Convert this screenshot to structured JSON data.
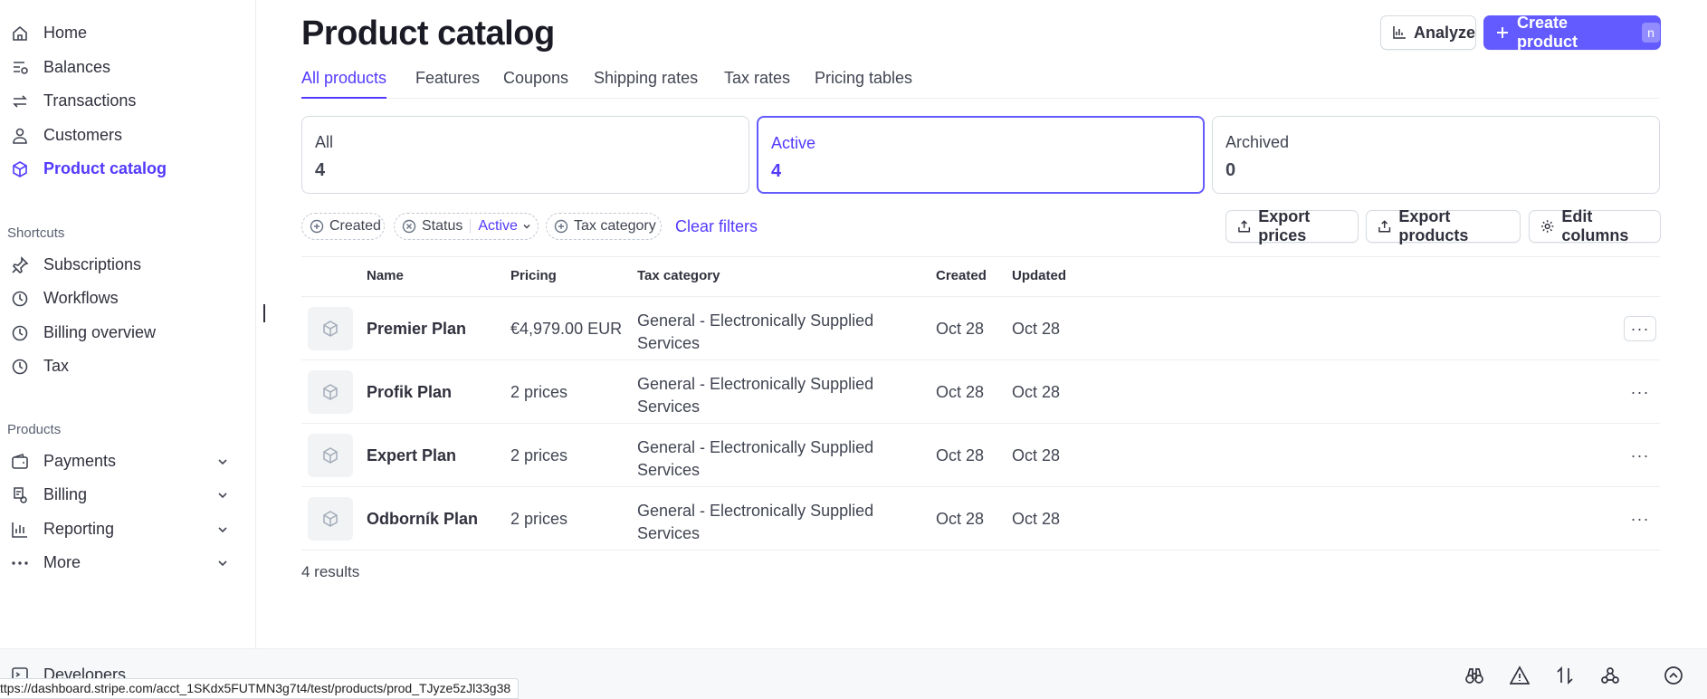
{
  "sidebar": {
    "items": [
      {
        "label": "Home",
        "icon": "home-icon"
      },
      {
        "label": "Balances",
        "icon": "balances-icon"
      },
      {
        "label": "Transactions",
        "icon": "transactions-icon"
      },
      {
        "label": "Customers",
        "icon": "customers-icon"
      },
      {
        "label": "Product catalog",
        "icon": "product-catalog-icon",
        "active": true
      }
    ],
    "shortcuts_label": "Shortcuts",
    "shortcuts": [
      {
        "label": "Subscriptions",
        "icon": "pin-icon"
      },
      {
        "label": "Workflows",
        "icon": "clock-icon"
      },
      {
        "label": "Billing overview",
        "icon": "clock-icon"
      },
      {
        "label": "Tax",
        "icon": "clock-icon"
      }
    ],
    "products_label": "Products",
    "products": [
      {
        "label": "Payments",
        "icon": "wallet-icon"
      },
      {
        "label": "Billing",
        "icon": "billing-icon"
      },
      {
        "label": "Reporting",
        "icon": "bar-chart-icon"
      },
      {
        "label": "More",
        "icon": "more-dots-icon"
      }
    ],
    "developers_label": "Developers"
  },
  "header": {
    "title": "Product catalog",
    "analyze_label": "Analyze",
    "create_label": "Create product",
    "create_shortcut": "n"
  },
  "tabs": [
    "All products",
    "Features",
    "Coupons",
    "Shipping rates",
    "Tax rates",
    "Pricing tables"
  ],
  "summary_cards": [
    {
      "label": "All",
      "value": "4"
    },
    {
      "label": "Active",
      "value": "4",
      "selected": true
    },
    {
      "label": "Archived",
      "value": "0"
    }
  ],
  "filters": {
    "created": "Created",
    "status": "Status",
    "status_value": "Active",
    "tax_category": "Tax category",
    "clear": "Clear filters"
  },
  "actions": {
    "export_prices": "Export prices",
    "export_products": "Export products",
    "edit_columns": "Edit columns"
  },
  "table": {
    "columns": [
      "Name",
      "Pricing",
      "Tax category",
      "Created",
      "Updated"
    ],
    "rows": [
      {
        "name": "Premier Plan",
        "pricing": "€4,979.00 EUR",
        "tax_line1": "General - Electronically Supplied",
        "tax_line2": "Services",
        "created": "Oct 28",
        "updated": "Oct 28"
      },
      {
        "name": "Profik Plan",
        "pricing": "2 prices",
        "tax_line1": "General - Electronically Supplied",
        "tax_line2": "Services",
        "created": "Oct 28",
        "updated": "Oct 28"
      },
      {
        "name": "Expert Plan",
        "pricing": "2 prices",
        "tax_line1": "General - Electronically Supplied",
        "tax_line2": "Services",
        "created": "Oct 28",
        "updated": "Oct 28"
      },
      {
        "name": "Odborník Plan",
        "pricing": "2 prices",
        "tax_line1": "General - Electronically Supplied",
        "tax_line2": "Services",
        "created": "Oct 28",
        "updated": "Oct 28"
      }
    ],
    "more_glyph": "···",
    "results": "4 results"
  },
  "status_url": "ttps://dashboard.stripe.com/acct_1SKdx5FUTMN3g7t4/test/products/prod_TJyze5zJl33g38",
  "colors": {
    "accent": "#533afd",
    "primary_button": "#635bff",
    "border": "#d5dbe1"
  }
}
